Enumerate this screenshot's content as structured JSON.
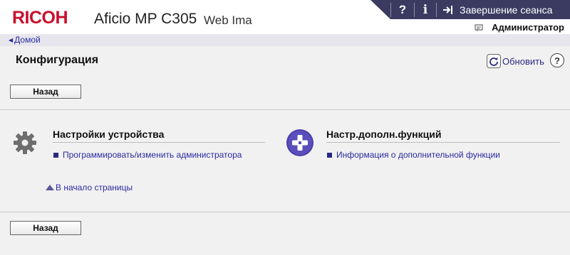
{
  "header": {
    "brand": "RICOH",
    "model": "Aficio MP C305",
    "product": "Web Ima",
    "help_label": "?",
    "info_label": "i",
    "logout_label": "Завершение сеанса",
    "user_label": "Администратор",
    "icons": {
      "help": "help-icon",
      "info": "info-icon",
      "logout": "logout-arrow-icon",
      "user": "user-card-icon"
    },
    "colors": {
      "topbar": "#3b3b62",
      "brand": "#c8102e"
    }
  },
  "breadcrumb": {
    "home_label": "Домой"
  },
  "page": {
    "title": "Конфигурация",
    "refresh_label": "Обновить",
    "help_label": "?",
    "back_label_top": "Назад",
    "back_label_bottom": "Назад",
    "to_top_label": "В начало страницы"
  },
  "sections": {
    "device": {
      "title": "Настройки устройства",
      "icon": "gear-icon",
      "links": [
        "Программировать/изменить администратора"
      ]
    },
    "extended": {
      "title": "Настр.дополн.функций",
      "icon": "plus-circle-icon",
      "links": [
        "Информация о дополнительной функции"
      ]
    }
  }
}
